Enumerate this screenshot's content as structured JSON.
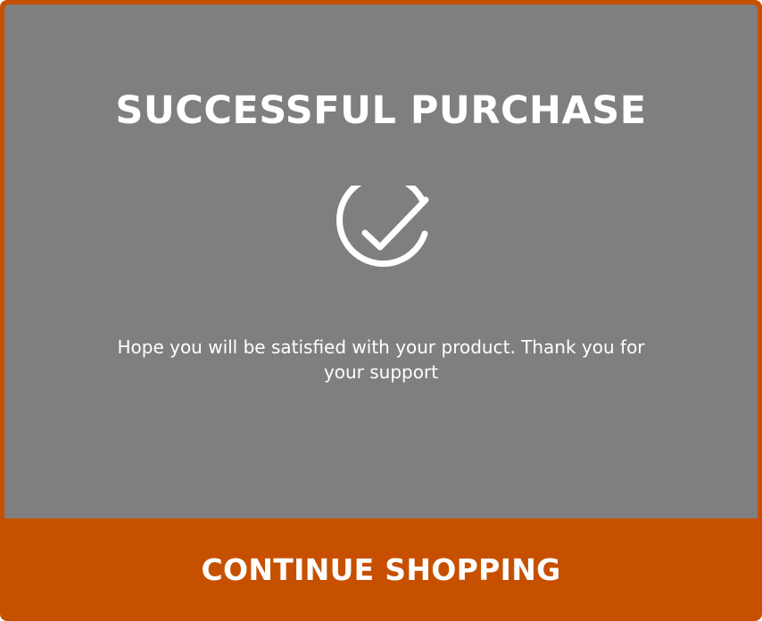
{
  "dialog": {
    "title": "SUCCESSFUL PURCHASE",
    "icon": "check-circle-icon",
    "message": "Hope you will be satisfied with your product. Thank you for your support",
    "button_label": "CONTINUE SHOPPING"
  },
  "colors": {
    "accent": "#c75000",
    "panel_background": "#7f7f7f",
    "text": "#ffffff"
  }
}
